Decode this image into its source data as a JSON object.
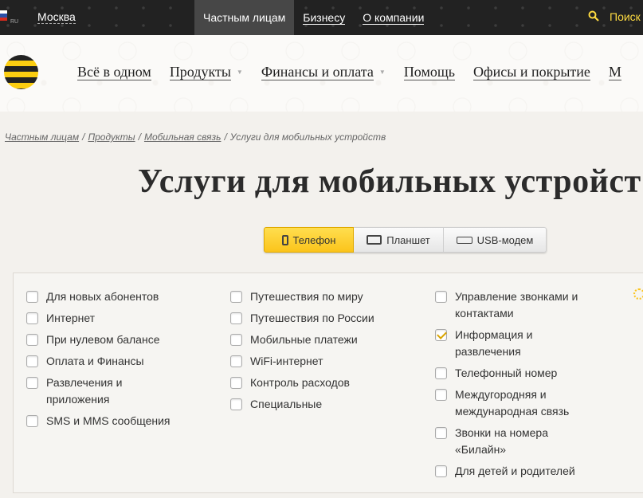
{
  "topbar": {
    "region_label": "RU",
    "city": "Москва",
    "nav": [
      {
        "label": "Частным лицам",
        "active": true
      },
      {
        "label": "Бизнесу",
        "active": false
      },
      {
        "label": "О компании",
        "active": false
      }
    ],
    "search_label": "Поиск"
  },
  "header": {
    "nav": [
      {
        "label": "Всё в одном",
        "dropdown": false
      },
      {
        "label": "Продукты",
        "dropdown": true
      },
      {
        "label": "Финансы и оплата",
        "dropdown": true
      },
      {
        "label": "Помощь",
        "dropdown": false
      },
      {
        "label": "Офисы и покрытие",
        "dropdown": false
      },
      {
        "label": "М",
        "dropdown": false
      }
    ]
  },
  "breadcrumb": {
    "items": [
      "Частным лицам",
      "Продукты",
      "Мобильная связь"
    ],
    "current": "Услуги для мобильных устройств"
  },
  "page_title": "Услуги для мобильных устройст",
  "device_tabs": [
    {
      "label": "Телефон",
      "icon": "phone-icon",
      "active": true
    },
    {
      "label": "Планшет",
      "icon": "tablet-icon",
      "active": false
    },
    {
      "label": "USB-модем",
      "icon": "usb-modem-icon",
      "active": false
    }
  ],
  "filters": {
    "col1": [
      {
        "label": "Для новых абонентов",
        "checked": false
      },
      {
        "label": "Интернет",
        "checked": false
      },
      {
        "label": "При нулевом балансе",
        "checked": false
      },
      {
        "label": "Оплата и Финансы",
        "checked": false
      },
      {
        "label": "Развлечения и приложения",
        "checked": false
      },
      {
        "label": "SMS и MMS сообщения",
        "checked": false
      }
    ],
    "col2": [
      {
        "label": "Путешествия по миру",
        "checked": false
      },
      {
        "label": "Путешествия по России",
        "checked": false
      },
      {
        "label": "Мобильные платежи",
        "checked": false
      },
      {
        "label": "WiFi-интернет",
        "checked": false
      },
      {
        "label": "Контроль расходов",
        "checked": false
      },
      {
        "label": "Специальные",
        "checked": false
      }
    ],
    "col3": [
      {
        "label": "Управление звонками и контактами",
        "checked": false
      },
      {
        "label": "Информация и развлечения",
        "checked": true
      },
      {
        "label": "Телефонный номер",
        "checked": false
      },
      {
        "label": "Междугородняя и международная связь",
        "checked": false
      },
      {
        "label": "Звонки на номера «Билайн»",
        "checked": false
      },
      {
        "label": "Для детей и родителей",
        "checked": false
      }
    ]
  },
  "colors": {
    "accent": "#fbc41b",
    "topbar_bg": "#222222",
    "page_bg": "#f3f1ed"
  }
}
